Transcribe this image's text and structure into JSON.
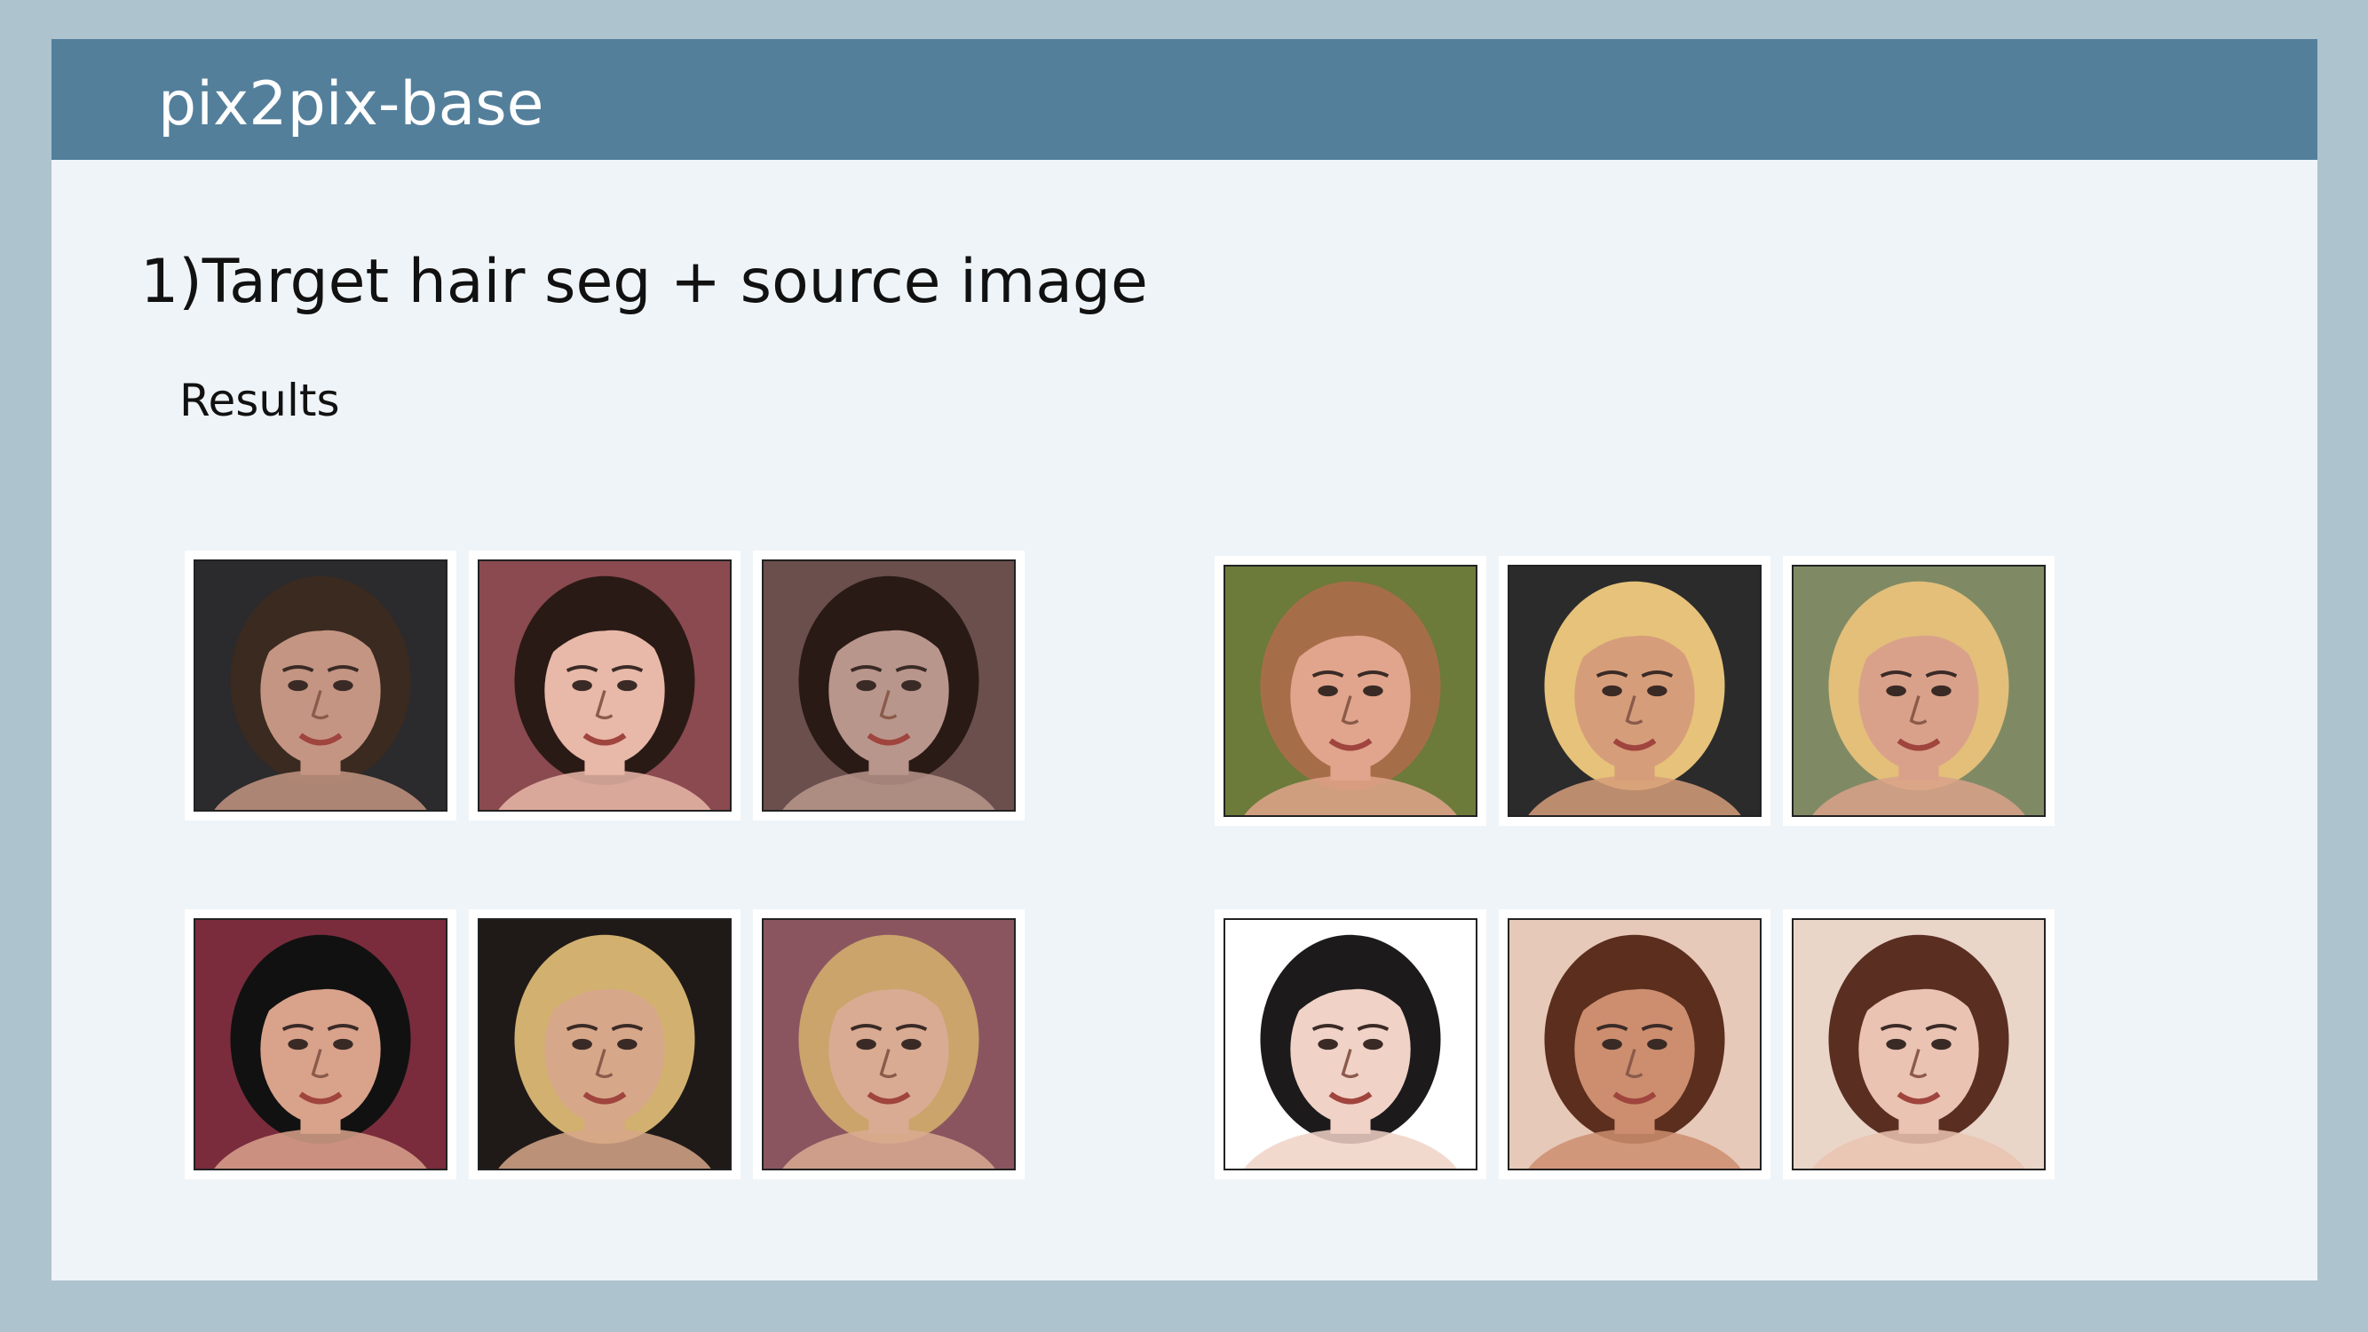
{
  "header": {
    "title": "pix2pix-base"
  },
  "section": {
    "heading": "1)Target hair seg + source image",
    "subheading": "Results"
  },
  "groups": [
    {
      "images": [
        {
          "icon": "face-photo-man-short-brown-hair-beard",
          "skin": "#c49582",
          "hair": "#3a2a20",
          "bg": "#2b2a2c"
        },
        {
          "icon": "face-photo-woman-long-dark-hair",
          "skin": "#e8b8a8",
          "hair": "#2a1a16",
          "bg": "#8a4a4f"
        },
        {
          "icon": "face-photo-man-long-dark-hair-result",
          "skin": "#b9968c",
          "hair": "#2a1a16",
          "bg": "#6a4f4d"
        }
      ]
    },
    {
      "images": [
        {
          "icon": "face-photo-man-light-brown-hair",
          "skin": "#e0a58c",
          "hair": "#a66e48",
          "bg": "#6c7a3a"
        },
        {
          "icon": "face-photo-woman-blonde-hair",
          "skin": "#d69d7a",
          "hair": "#e6c27a",
          "bg": "#2b2b2b"
        },
        {
          "icon": "face-photo-man-blonde-hair-result",
          "skin": "#d9a18a",
          "hair": "#e3bf7a",
          "bg": "#7f8a65"
        }
      ]
    },
    {
      "images": [
        {
          "icon": "face-photo-man-black-hair",
          "skin": "#d9a28b",
          "hair": "#111111",
          "bg": "#7a2c3c"
        },
        {
          "icon": "face-photo-woman-short-blonde-hair",
          "skin": "#d7a78a",
          "hair": "#d2b06f",
          "bg": "#1f1a18"
        },
        {
          "icon": "face-photo-man-short-blonde-hair-result",
          "skin": "#d9ab92",
          "hair": "#caa46b",
          "bg": "#8b5560"
        }
      ]
    },
    {
      "images": [
        {
          "icon": "face-photo-woman-dark-hair",
          "skin": "#f0d2c6",
          "hair": "#1d1a1c",
          "bg": "#ffffff"
        },
        {
          "icon": "face-photo-woman-brown-hair",
          "skin": "#cc8e6f",
          "hair": "#5b2e1d",
          "bg": "#e7c9b9"
        },
        {
          "icon": "face-photo-woman-brown-hair-result",
          "skin": "#eac3b2",
          "hair": "#5a2f22",
          "bg": "#ead5c9"
        }
      ]
    }
  ]
}
